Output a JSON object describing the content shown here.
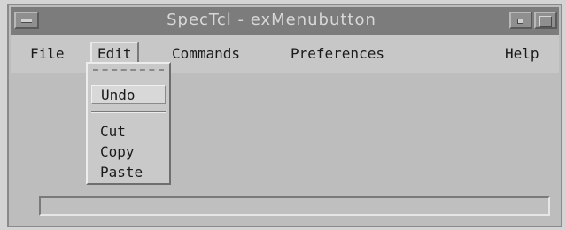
{
  "window": {
    "title": "SpecTcl - exMenubutton"
  },
  "menubar": {
    "items": [
      {
        "label": "File"
      },
      {
        "label": "Edit"
      },
      {
        "label": "Commands"
      },
      {
        "label": "Preferences"
      },
      {
        "label": "Help"
      }
    ],
    "active": "Edit"
  },
  "edit_menu": {
    "items": [
      {
        "label": "Undo"
      },
      {
        "label": "Cut"
      },
      {
        "label": "Copy"
      },
      {
        "label": "Paste"
      }
    ],
    "highlighted": "Undo"
  },
  "status_field": {
    "value": ""
  },
  "icons": {
    "window_menu": "window-menu-icon",
    "minimize": "minimize-icon",
    "maximize": "maximize-icon"
  },
  "colors": {
    "titlebar": "#7c7c7c",
    "background": "#bdbdbd",
    "menubar": "#c7c7c7"
  }
}
